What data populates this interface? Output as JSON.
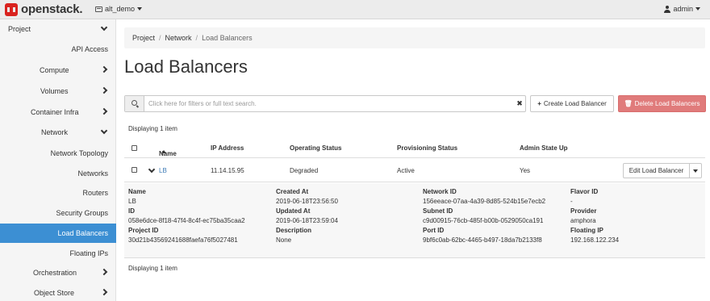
{
  "topbar": {
    "brand": "openstack.",
    "project": "alt_demo",
    "user": "admin"
  },
  "sidebar": {
    "items": [
      {
        "label": "Project"
      },
      {
        "label": "API Access"
      },
      {
        "label": "Compute"
      },
      {
        "label": "Volumes"
      },
      {
        "label": "Container Infra"
      },
      {
        "label": "Network"
      },
      {
        "label": "Network Topology"
      },
      {
        "label": "Networks"
      },
      {
        "label": "Routers"
      },
      {
        "label": "Security Groups"
      },
      {
        "label": "Load Balancers"
      },
      {
        "label": "Floating IPs"
      },
      {
        "label": "Orchestration"
      },
      {
        "label": "Object Store"
      }
    ],
    "active": "Load Balancers"
  },
  "breadcrumb": [
    "Project",
    "Network",
    "Load Balancers"
  ],
  "page_title": "Load Balancers",
  "filter": {
    "placeholder": "Click here for filters or full text search.",
    "clear": "✖"
  },
  "actions": {
    "create": "Create Load Balancer",
    "delete": "Delete Load Balancers"
  },
  "displaying_top": "Displaying 1 item",
  "displaying_bottom": "Displaying 1 item",
  "table": {
    "columns": [
      "Name",
      "IP Address",
      "Operating Status",
      "Provisioning Status",
      "Admin State Up"
    ],
    "rows": [
      {
        "name": "LB",
        "ip": "11.14.15.95",
        "operating_status": "Degraded",
        "provisioning_status": "Active",
        "admin_state_up": "Yes",
        "action": "Edit Load Balancer"
      }
    ]
  },
  "detail": {
    "name_label": "Name",
    "name": "LB",
    "id_label": "ID",
    "id": "058e6dce-8f18-47f4-8c4f-ec75ba35caa2",
    "project_id_label": "Project ID",
    "project_id": "30d21b43569241688faefa76f5027481",
    "created_label": "Created At",
    "created": "2019-06-18T23:56:50",
    "updated_label": "Updated At",
    "updated": "2019-06-18T23:59:04",
    "description_label": "Description",
    "description": "None",
    "network_id_label": "Network ID",
    "network_id": "156eeace-07aa-4a39-8d85-524b15e7ecb2",
    "subnet_id_label": "Subnet ID",
    "subnet_id": "c9d00915-76cb-485f-b00b-0529050ca191",
    "port_id_label": "Port ID",
    "port_id": "9bf6c0ab-62bc-4465-b497-18da7b2133f8",
    "flavor_id_label": "Flavor ID",
    "flavor_id": "-",
    "provider_label": "Provider",
    "provider": "amphora",
    "floating_ip_label": "Floating IP",
    "floating_ip": "192.168.122.234"
  },
  "colors": {
    "active_nav": "#3c8fd3",
    "delete_button": "#e07b7b",
    "brand_red": "#d9231f",
    "link": "#3c7ab5"
  }
}
